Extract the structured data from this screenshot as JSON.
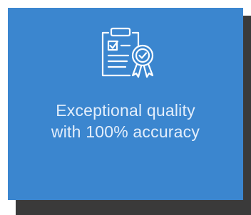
{
  "card": {
    "icon": "checklist-clipboard-certificate-icon",
    "line1": "Exceptional quality",
    "line2": "with 100% accuracy"
  },
  "colors": {
    "card_background": "#3b86cf",
    "shadow": "#3a3a3a",
    "text": "#e3eefb",
    "icon_stroke": "#ffffff"
  }
}
